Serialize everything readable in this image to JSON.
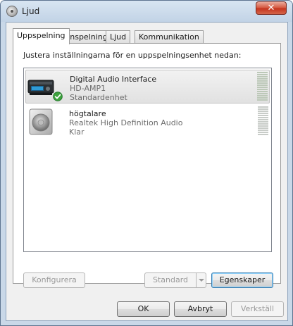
{
  "window": {
    "title": "Ljud",
    "close_label": "✕"
  },
  "tabs": [
    {
      "label": "Uppspelning",
      "active": true
    },
    {
      "label": "Inspelning",
      "active": false
    },
    {
      "label": "Ljud",
      "active": false
    },
    {
      "label": "Kommunikation",
      "active": false
    }
  ],
  "panel": {
    "instruction": "Justera inställningarna för en uppspelningsenhet nedan:"
  },
  "devices": [
    {
      "name": "Digital Audio Interface",
      "description": "HD-AMP1",
      "status": "Standardenhet",
      "selected": true,
      "icon": "audio-interface-icon",
      "badge": "default-checkmark-icon"
    },
    {
      "name": "högtalare",
      "description": "Realtek High Definition Audio",
      "status": "Klar",
      "selected": false,
      "icon": "speaker-icon"
    }
  ],
  "buttons": {
    "configure": "Konfigurera",
    "set_default": "Standard",
    "properties": "Egenskaper",
    "ok": "OK",
    "cancel": "Avbryt",
    "apply": "Verkställ"
  },
  "colors": {
    "selection_accent": "#c4c4c4",
    "default_badge": "#3da33d",
    "default_button_border": "#3c7fb1"
  }
}
